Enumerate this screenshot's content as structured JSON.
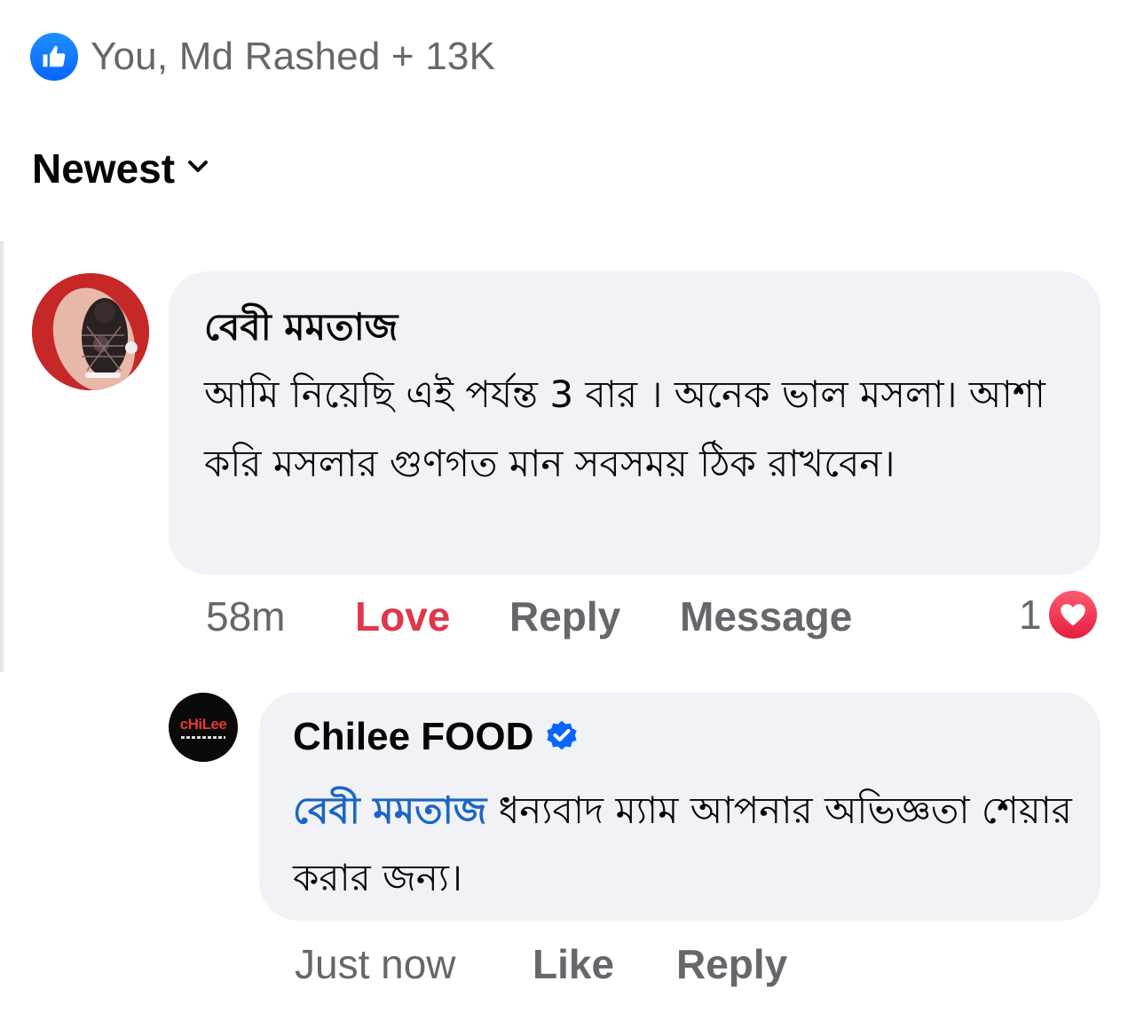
{
  "reactions_summary": {
    "icon": "thumbs-up-icon",
    "text": "You, Md Rashed + 13K"
  },
  "sort": {
    "label": "Newest",
    "icon": "chevron-down-icon"
  },
  "comment": {
    "author": "বেবী মমতাজ",
    "text": "আমি নিয়েছি এই পর্যন্ত 3 বার । অনেক ভাল মসলা। আশা করি মসলার গুণগত মান সবসময় ঠিক রাখবেন।",
    "time": "58m",
    "love_label": "Love",
    "reply_label": "Reply",
    "message_label": "Message",
    "reaction_count": "1",
    "reaction_icon": "heart-icon"
  },
  "reply": {
    "author": "Chilee FOOD",
    "verified_icon": "verified-badge-icon",
    "avatar_logo_text": "cHiLee",
    "mention": "বেবী মমতাজ",
    "text": " ধন্যবাদ ম্যাম আপনার অভিজ্ঞতা শেয়ার করার জন্য।",
    "time": "Just now",
    "like_label": "Like",
    "reply_label": "Reply"
  },
  "colors": {
    "accent_blue": "#0866ff",
    "love_red": "#e0374a",
    "mention_blue": "#1b65c7",
    "bubble_gray": "#f0f2f5",
    "meta_gray": "#65676b"
  }
}
